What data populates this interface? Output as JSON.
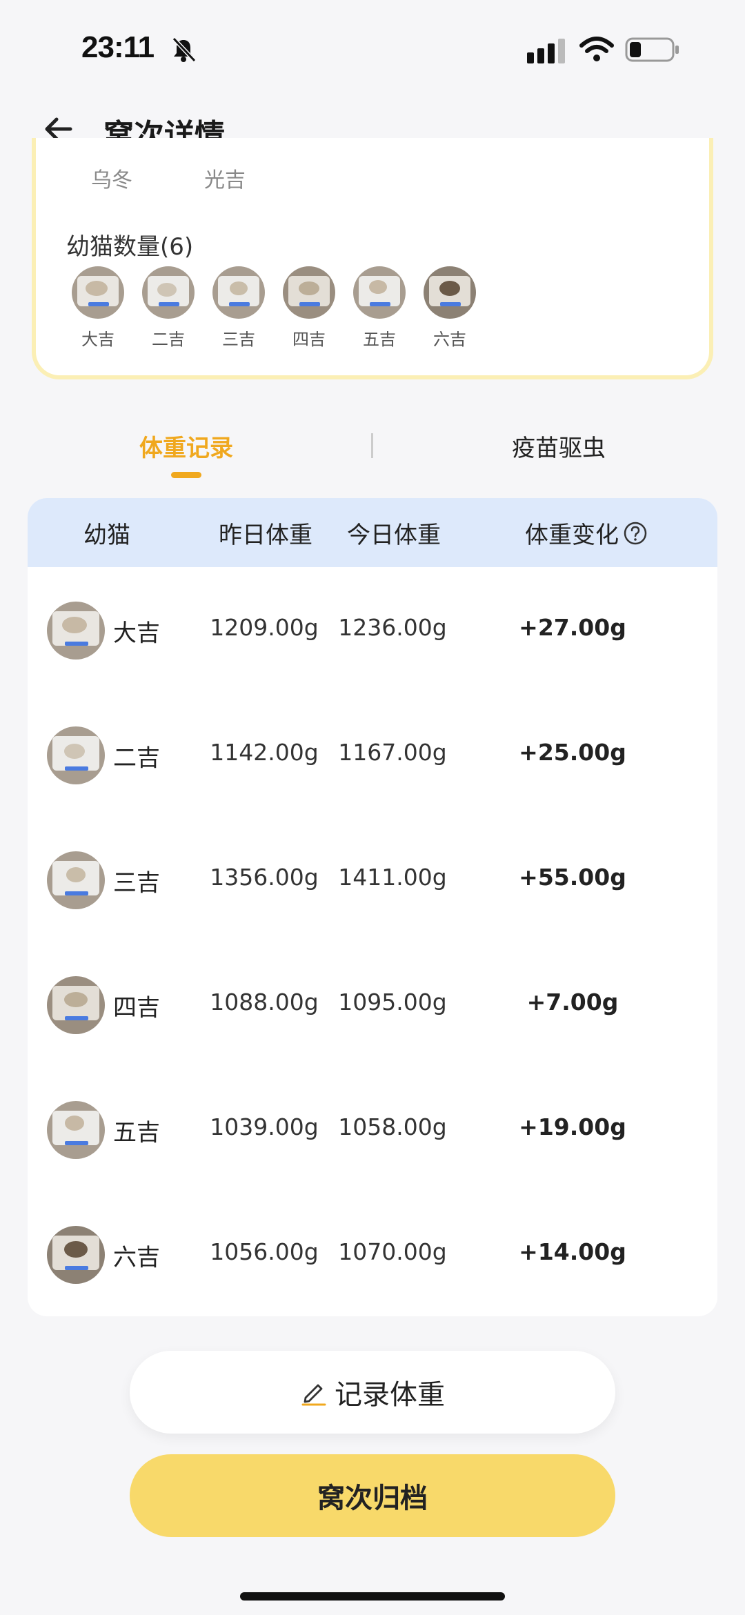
{
  "status_bar": {
    "time": "23:11",
    "icons": [
      "mute-bell-icon",
      "signal-icon",
      "wifi-icon",
      "battery-icon"
    ]
  },
  "header": {
    "title": "窝次详情",
    "back_icon": "back-arrow-icon"
  },
  "card": {
    "parents": [
      "乌冬",
      "光吉"
    ],
    "kitten_count_label": "幼猫数量(6)",
    "kittens": [
      {
        "name": "大吉"
      },
      {
        "name": "二吉"
      },
      {
        "name": "三吉"
      },
      {
        "name": "四吉"
      },
      {
        "name": "五吉"
      },
      {
        "name": "六吉"
      }
    ]
  },
  "tabs": [
    {
      "label": "体重记录",
      "active": true
    },
    {
      "label": "疫苗驱虫",
      "active": false
    }
  ],
  "table": {
    "headers": [
      "幼猫",
      "昨日体重",
      "今日体重",
      "体重变化"
    ],
    "rows": [
      {
        "name": "大吉",
        "yesterday": "1209.00g",
        "today": "1236.00g",
        "change": "+27.00g"
      },
      {
        "name": "二吉",
        "yesterday": "1142.00g",
        "today": "1167.00g",
        "change": "+25.00g"
      },
      {
        "name": "三吉",
        "yesterday": "1356.00g",
        "today": "1411.00g",
        "change": "+55.00g"
      },
      {
        "name": "四吉",
        "yesterday": "1088.00g",
        "today": "1095.00g",
        "change": "+7.00g"
      },
      {
        "name": "五吉",
        "yesterday": "1039.00g",
        "today": "1058.00g",
        "change": "+19.00g"
      },
      {
        "name": "六吉",
        "yesterday": "1056.00g",
        "today": "1070.00g",
        "change": "+14.00g"
      }
    ]
  },
  "buttons": {
    "record_label": "记录体重",
    "archive_label": "窝次归档"
  },
  "colors": {
    "accent": "#f0a81e",
    "archive_button": "#f8d96a",
    "table_header_bg": "#dde9fb",
    "card_border": "#fbefb5"
  }
}
